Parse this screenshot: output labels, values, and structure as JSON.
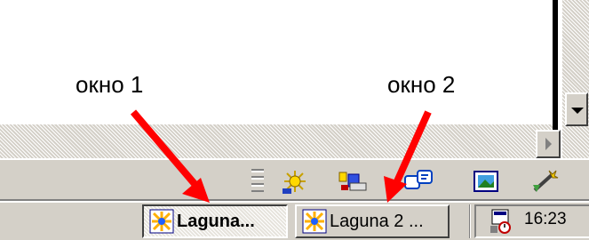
{
  "annotations": {
    "window1_label": "окно 1",
    "window2_label": "окно 2",
    "arrow_color": "#ff0000"
  },
  "toolbar": {
    "icons": [
      "sun-gear-icon",
      "office-tools-icon",
      "chat-bubbles-icon",
      "picture-frame-icon",
      "magic-wand-icon"
    ]
  },
  "taskbar": {
    "buttons": [
      {
        "label": "Laguna...",
        "active": true,
        "icon": "laguna-app-icon"
      },
      {
        "label": "Laguna 2 ...",
        "active": false,
        "icon": "laguna-app-icon"
      }
    ],
    "tray": {
      "clock": "16:23",
      "icon": "scheduler-icon"
    }
  },
  "colors": {
    "face": "#d4d0c8",
    "arrow": "#ff0000"
  }
}
